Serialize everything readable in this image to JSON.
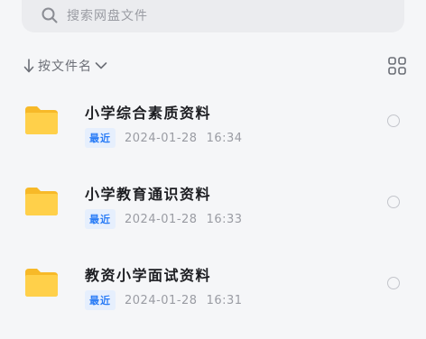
{
  "search": {
    "placeholder": "搜索网盘文件",
    "icon": "search-icon"
  },
  "sort": {
    "label": "按文件名",
    "direction_icon": "arrow-down-icon",
    "dropdown_icon": "chevron-down-icon"
  },
  "view_toggle": {
    "icon": "grid-view-icon"
  },
  "files": [
    {
      "name": "小学综合素质资料",
      "badge": "最近",
      "date": "2024-01-28",
      "time": "16:34",
      "icon": "folder-icon"
    },
    {
      "name": "小学教育通识资料",
      "badge": "最近",
      "date": "2024-01-28",
      "time": "16:33",
      "icon": "folder-icon"
    },
    {
      "name": "教资小学面试资料",
      "badge": "最近",
      "date": "2024-01-28",
      "time": "16:31",
      "icon": "folder-icon"
    }
  ],
  "colors": {
    "folder": "#ffcc3a",
    "badge_text": "#2a7cf6",
    "badge_bg": "#e6effd"
  }
}
